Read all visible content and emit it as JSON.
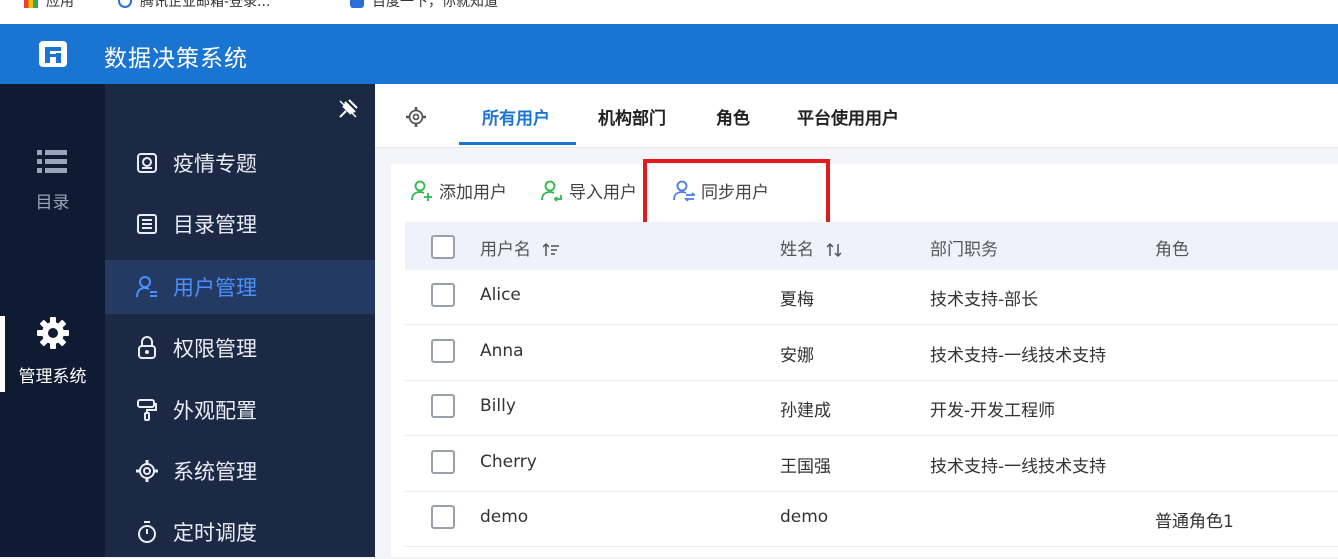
{
  "bookmarks": [
    {
      "label": "应用"
    },
    {
      "label": "腾讯企业邮箱-登录..."
    },
    {
      "label": "百度一下，你就知道"
    }
  ],
  "header": {
    "title": "数据决策系统"
  },
  "rail": {
    "catalog": {
      "label": "目录",
      "icon": "list-icon"
    },
    "manage": {
      "label": "管理系统",
      "icon": "gear-icon"
    }
  },
  "sidebar": {
    "items": [
      {
        "label": "疫情专题",
        "icon": "dashboard-icon"
      },
      {
        "label": "目录管理",
        "icon": "catalog-icon"
      },
      {
        "label": "用户管理",
        "icon": "user-icon",
        "active": true
      },
      {
        "label": "权限管理",
        "icon": "lock-icon"
      },
      {
        "label": "外观配置",
        "icon": "paint-roller-icon"
      },
      {
        "label": "系统管理",
        "icon": "gear-icon"
      },
      {
        "label": "定时调度",
        "icon": "timer-icon"
      }
    ]
  },
  "tabs": [
    {
      "label": "所有用户",
      "active": true
    },
    {
      "label": "机构部门"
    },
    {
      "label": "角色"
    },
    {
      "label": "平台使用用户"
    }
  ],
  "actions": {
    "add": "添加用户",
    "import": "导入用户",
    "sync": "同步用户"
  },
  "table": {
    "headers": {
      "username": "用户名",
      "name": "姓名",
      "dept": "部门职务",
      "role": "角色"
    },
    "rows": [
      {
        "username": "Alice",
        "name": "夏梅",
        "dept": "技术支持-部长",
        "role": ""
      },
      {
        "username": "Anna",
        "name": "安娜",
        "dept": "技术支持-一线技术支持",
        "role": ""
      },
      {
        "username": "Billy",
        "name": "孙建成",
        "dept": "开发-开发工程师",
        "role": ""
      },
      {
        "username": "Cherry",
        "name": "王国强",
        "dept": "技术支持-一线技术支持",
        "role": ""
      },
      {
        "username": "demo",
        "name": "demo",
        "dept": "",
        "role": "普通角色1"
      }
    ]
  },
  "colors": {
    "header": "#1a74d2",
    "rail": "#0f1a33",
    "sidebar": "#1c2945",
    "sidebar_active": "#243a63",
    "accent": "#4a90ff",
    "highlight": "#e11b1b",
    "add_icon": "#2db84d"
  }
}
